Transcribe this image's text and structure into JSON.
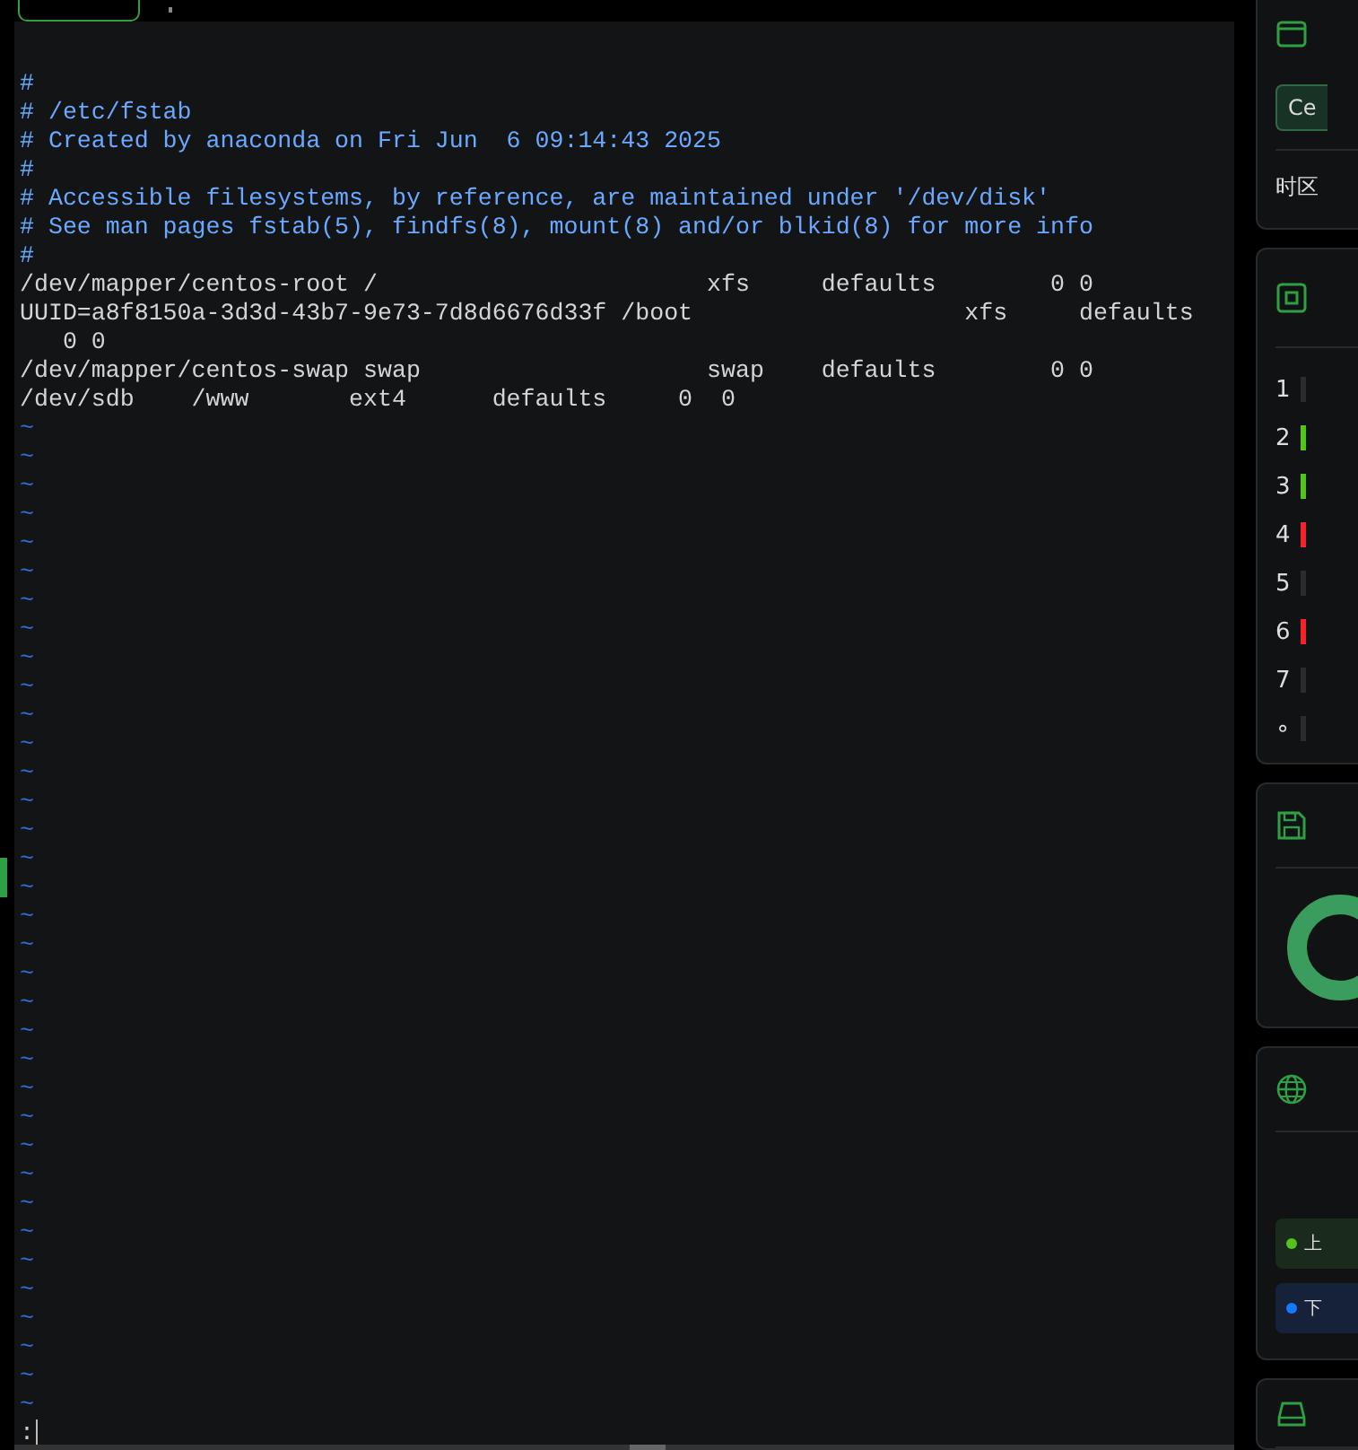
{
  "editor": {
    "lines": [
      "#",
      "# /etc/fstab",
      "# Created by anaconda on Fri Jun  6 09:14:43 2025",
      "#",
      "# Accessible filesystems, by reference, are maintained under '/dev/disk'",
      "# See man pages fstab(5), findfs(8), mount(8) and/or blkid(8) for more info",
      "#",
      "/dev/mapper/centos-root /                       xfs     defaults        0 0",
      "UUID=a8f8150a-3d3d-43b7-9e73-7d8d6676d33f /boot                   xfs     defaults",
      "   0 0",
      "/dev/mapper/centos-swap swap                    swap    defaults        0 0",
      "/dev/sdb    /www       ext4      defaults     0  0"
    ],
    "empty_lines": [
      "~",
      "~",
      "~",
      "~",
      "~",
      "~",
      "~",
      "~",
      "~",
      "~",
      "~",
      "~",
      "~",
      "~",
      "~",
      "~",
      "~",
      "~",
      "~",
      "~",
      "~",
      "~",
      "~",
      "~",
      "~",
      "~",
      "~",
      "~",
      "~",
      "~",
      "~",
      "~",
      "~",
      "~",
      "~"
    ],
    "command_line": ":"
  },
  "side_panel": {
    "system_card": {
      "button": "Ce",
      "label": "时区"
    },
    "cpu_card": {
      "rows": [
        {
          "label": "1",
          "color": "#2a2c2e"
        },
        {
          "label": "2",
          "color": "#52c41a"
        },
        {
          "label": "3",
          "color": "#52c41a"
        },
        {
          "label": "4",
          "color": "#f5222d"
        },
        {
          "label": "5",
          "color": "#2a2c2e"
        },
        {
          "label": "6",
          "color": "#f5222d"
        },
        {
          "label": "7",
          "color": "#2a2c2e"
        },
        {
          "label": "∘",
          "color": "#2a2c2e"
        }
      ]
    },
    "network_card": {
      "pills": [
        {
          "label": "上",
          "color": "#52c41a"
        },
        {
          "label": "下",
          "color": "#1677ff"
        }
      ]
    }
  }
}
